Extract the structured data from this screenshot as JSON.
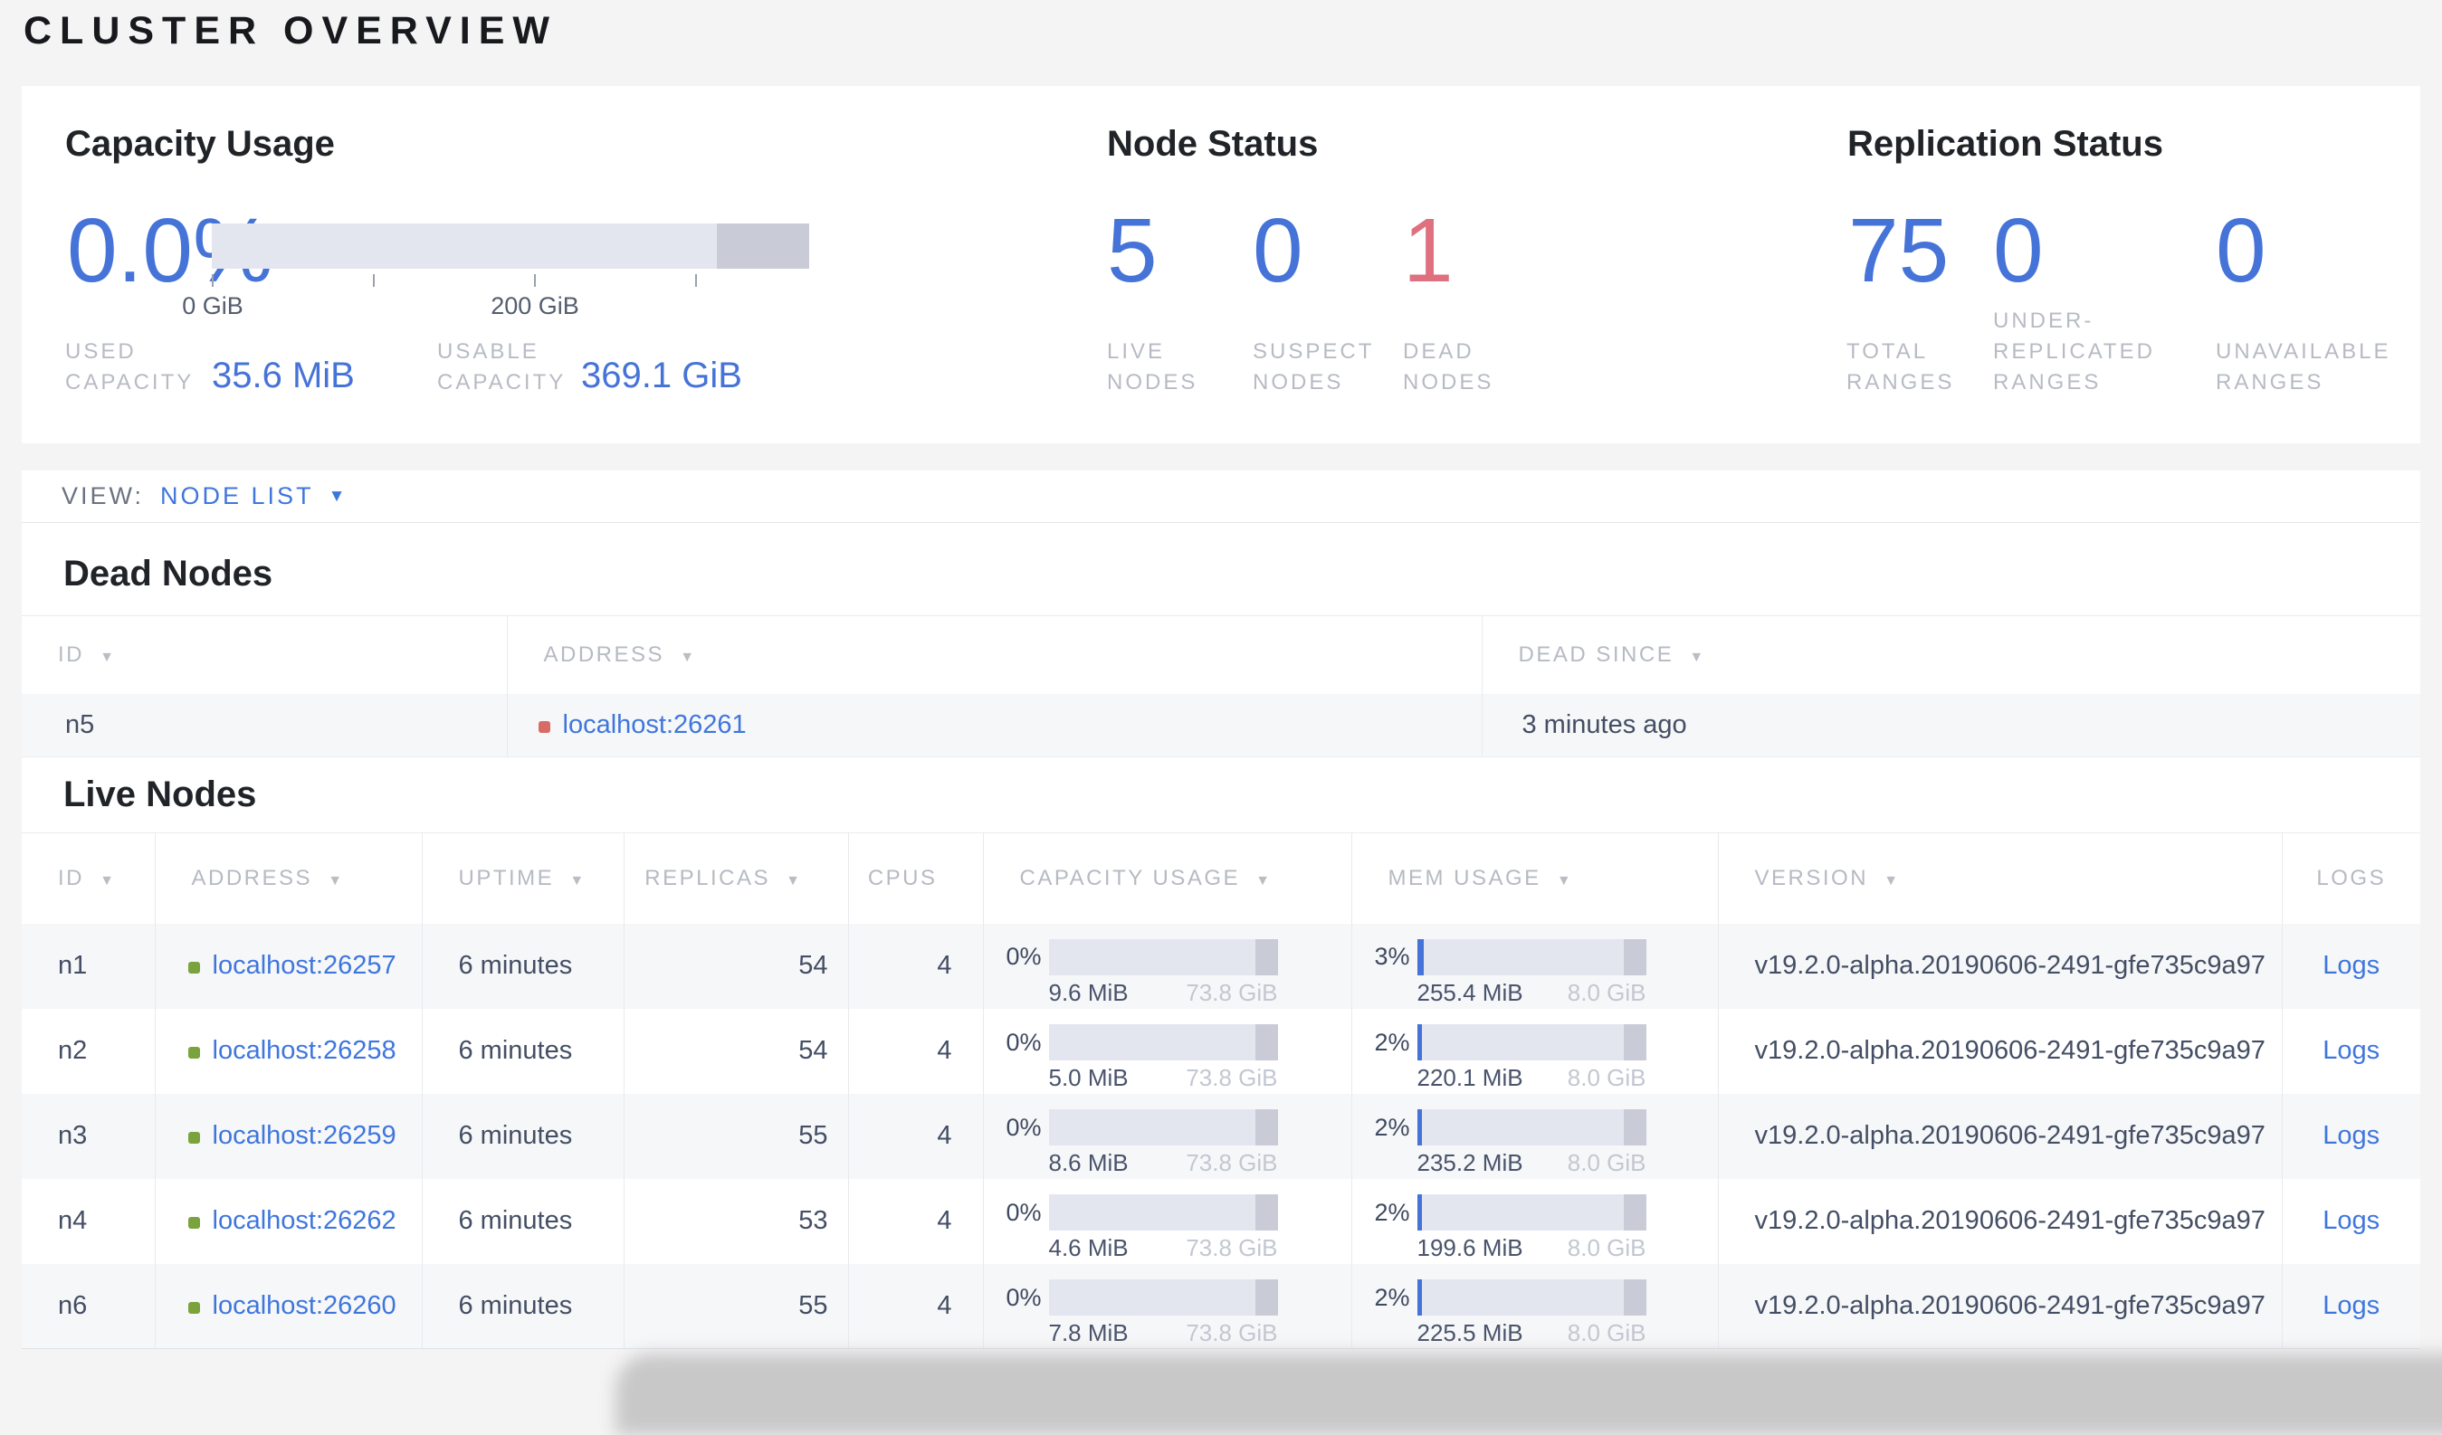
{
  "page": {
    "title": "CLUSTER OVERVIEW"
  },
  "colors": {
    "accent_blue": "#4573d8",
    "danger_red": "#de7080",
    "link_blue": "#3f76dd",
    "dot_green": "#7aa33e",
    "dot_red": "#d96b66",
    "bar_track": "#e4e6ef",
    "bar_endcap": "#c9ccd7"
  },
  "icons": {
    "sort": "▼",
    "caret": "▼"
  },
  "summary": {
    "capacity": {
      "title": "Capacity Usage",
      "percent": "0.0%",
      "axis_ticks": [
        "0 GiB",
        "200 GiB"
      ],
      "used_label": "USED\nCAPACITY",
      "used_value": "35.6 MiB",
      "usable_label": "USABLE\nCAPACITY",
      "usable_value": "369.1 GiB"
    },
    "node_status": {
      "title": "Node Status",
      "metrics": [
        {
          "value": "5",
          "label": "LIVE\nNODES"
        },
        {
          "value": "0",
          "label": "SUSPECT\nNODES"
        },
        {
          "value": "1",
          "label": "DEAD\nNODES"
        }
      ]
    },
    "replication": {
      "title": "Replication Status",
      "metrics": [
        {
          "value": "75",
          "label": "TOTAL\nRANGES"
        },
        {
          "value": "0",
          "label": "UNDER-\nREPLICATED\nRANGES"
        },
        {
          "value": "0",
          "label": "UNAVAILABLE\nRANGES"
        }
      ]
    }
  },
  "view_bar": {
    "label": "VIEW:",
    "selected": "NODE LIST"
  },
  "dead_nodes": {
    "heading": "Dead Nodes",
    "columns": [
      {
        "label": "ID",
        "sortable": true
      },
      {
        "label": "ADDRESS",
        "sortable": true
      },
      {
        "label": "DEAD SINCE",
        "sortable": true
      }
    ],
    "rows": [
      {
        "id": "n5",
        "address": "localhost:26261",
        "dead_since": "3 minutes ago"
      }
    ]
  },
  "live_nodes": {
    "heading": "Live Nodes",
    "columns": [
      {
        "label": "ID",
        "sortable": true
      },
      {
        "label": "ADDRESS",
        "sortable": true
      },
      {
        "label": "UPTIME",
        "sortable": true
      },
      {
        "label": "REPLICAS",
        "sortable": true
      },
      {
        "label": "CPUS",
        "sortable": false
      },
      {
        "label": "CAPACITY USAGE",
        "sortable": true
      },
      {
        "label": "MEM USAGE",
        "sortable": true
      },
      {
        "label": "VERSION",
        "sortable": true
      },
      {
        "label": "LOGS",
        "sortable": false
      }
    ],
    "rows": [
      {
        "id": "n1",
        "address": "localhost:26257",
        "uptime": "6 minutes",
        "replicas": "54",
        "cpus": "4",
        "capacity": {
          "pct": "0%",
          "pct_num": 0,
          "used": "9.6 MiB",
          "total": "73.8 GiB"
        },
        "memory": {
          "pct": "3%",
          "pct_num": 3,
          "used": "255.4 MiB",
          "total": "8.0 GiB"
        },
        "version": "v19.2.0-alpha.20190606-2491-gfe735c9a97",
        "logs_label": "Logs"
      },
      {
        "id": "n2",
        "address": "localhost:26258",
        "uptime": "6 minutes",
        "replicas": "54",
        "cpus": "4",
        "capacity": {
          "pct": "0%",
          "pct_num": 0,
          "used": "5.0 MiB",
          "total": "73.8 GiB"
        },
        "memory": {
          "pct": "2%",
          "pct_num": 2,
          "used": "220.1 MiB",
          "total": "8.0 GiB"
        },
        "version": "v19.2.0-alpha.20190606-2491-gfe735c9a97",
        "logs_label": "Logs"
      },
      {
        "id": "n3",
        "address": "localhost:26259",
        "uptime": "6 minutes",
        "replicas": "55",
        "cpus": "4",
        "capacity": {
          "pct": "0%",
          "pct_num": 0,
          "used": "8.6 MiB",
          "total": "73.8 GiB"
        },
        "memory": {
          "pct": "2%",
          "pct_num": 2,
          "used": "235.2 MiB",
          "total": "8.0 GiB"
        },
        "version": "v19.2.0-alpha.20190606-2491-gfe735c9a97",
        "logs_label": "Logs"
      },
      {
        "id": "n4",
        "address": "localhost:26262",
        "uptime": "6 minutes",
        "replicas": "53",
        "cpus": "4",
        "capacity": {
          "pct": "0%",
          "pct_num": 0,
          "used": "4.6 MiB",
          "total": "73.8 GiB"
        },
        "memory": {
          "pct": "2%",
          "pct_num": 2,
          "used": "199.6 MiB",
          "total": "8.0 GiB"
        },
        "version": "v19.2.0-alpha.20190606-2491-gfe735c9a97",
        "logs_label": "Logs"
      },
      {
        "id": "n6",
        "address": "localhost:26260",
        "uptime": "6 minutes",
        "replicas": "55",
        "cpus": "4",
        "capacity": {
          "pct": "0%",
          "pct_num": 0,
          "used": "7.8 MiB",
          "total": "73.8 GiB"
        },
        "memory": {
          "pct": "2%",
          "pct_num": 2,
          "used": "225.5 MiB",
          "total": "8.0 GiB"
        },
        "version": "v19.2.0-alpha.20190606-2491-gfe735c9a97",
        "logs_label": "Logs"
      }
    ]
  }
}
